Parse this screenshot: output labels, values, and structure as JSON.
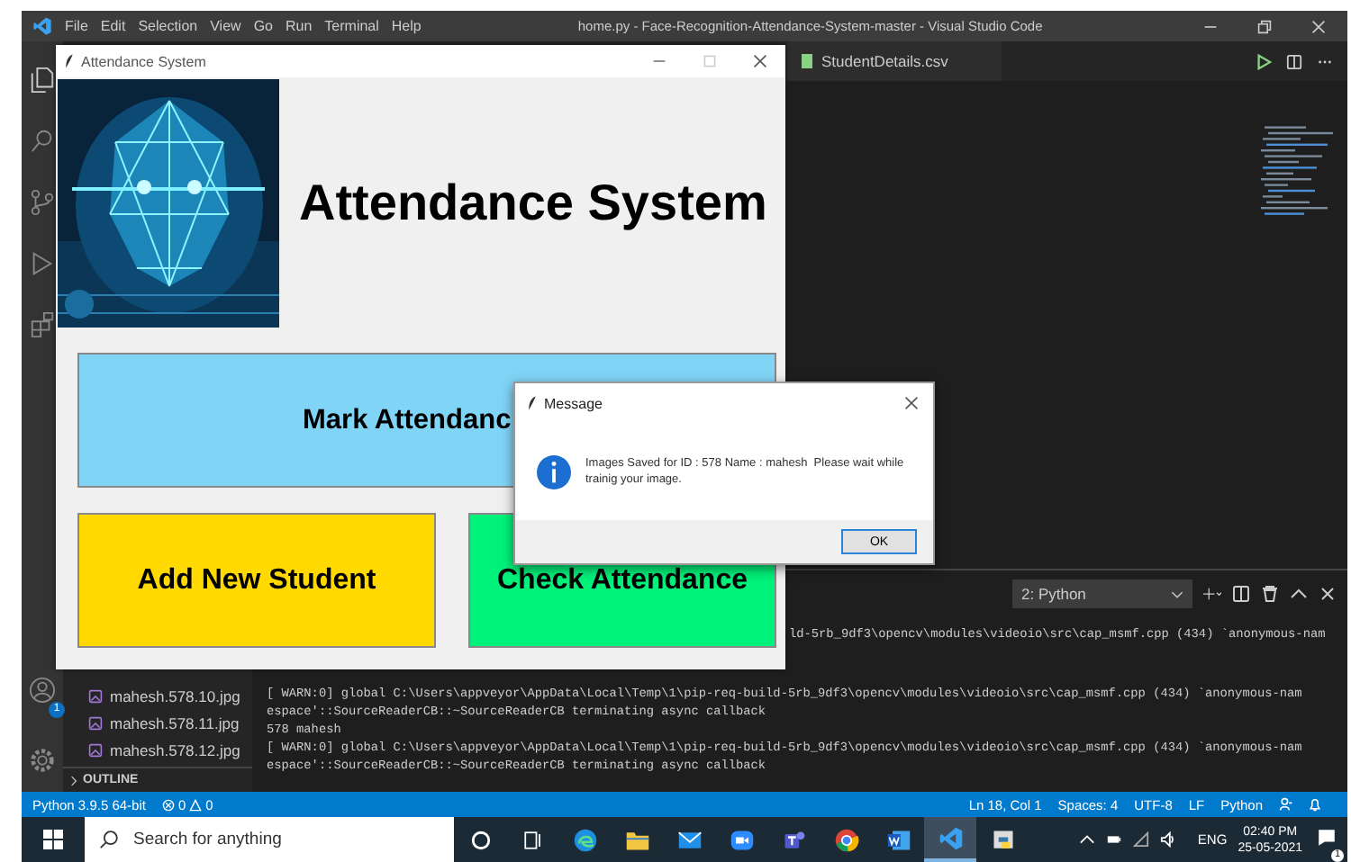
{
  "vscode": {
    "title": "home.py - Face-Recognition-Attendance-System-master - Visual Studio Code",
    "menu": [
      "File",
      "Edit",
      "Selection",
      "View",
      "Go",
      "Run",
      "Terminal",
      "Help"
    ],
    "accounts_badge": "1",
    "explorer": {
      "files": [
        "mahesh.578.10.jpg",
        "mahesh.578.11.jpg",
        "mahesh.578.12.jpg"
      ],
      "outline": "OUTLINE"
    },
    "editor_tab": "StudentDetails.csv",
    "terminal": {
      "selector": "2: Python",
      "lines": [
        {
          "kind": "clipped",
          "text": "ld-5rb_9df3\\opencv\\modules\\videoio\\src\\cap_msmf.cpp (434) `anonymous-nam"
        },
        {
          "kind": "full",
          "text": "[ WARN:0] global C:\\Users\\appveyor\\AppData\\Local\\Temp\\1\\pip-req-build-5rb_9df3\\opencv\\modules\\videoio\\src\\cap_msmf.cpp (434) `anonymous-nam"
        },
        {
          "kind": "full",
          "text": "espace'::SourceReaderCB::~SourceReaderCB terminating async callback"
        },
        {
          "kind": "full",
          "text": "578 mahesh"
        },
        {
          "kind": "full",
          "text": "[ WARN:0] global C:\\Users\\appveyor\\AppData\\Local\\Temp\\1\\pip-req-build-5rb_9df3\\opencv\\modules\\videoio\\src\\cap_msmf.cpp (434) `anonymous-nam"
        },
        {
          "kind": "full",
          "text": "espace'::SourceReaderCB::~SourceReaderCB terminating async callback"
        }
      ]
    },
    "status_bar": {
      "interpreter": "Python 3.9.5 64-bit",
      "errors": "0",
      "warnings": "0",
      "right": [
        "Ln 18, Col 1",
        "Spaces: 4",
        "UTF-8",
        "LF",
        "Python"
      ]
    }
  },
  "app_window": {
    "title": "Attendance System",
    "heading": "Attendance System",
    "buttons": [
      {
        "label": "Mark Attendanc",
        "color": "#80d4f6"
      },
      {
        "label": "Add New Student",
        "color": "#ffd900"
      },
      {
        "label": "Check Attendance",
        "color": "#00f27a"
      }
    ]
  },
  "message_dialog": {
    "title": "Message",
    "text": "Images Saved for ID : 578 Name : mahesh  Please wait while trainig your image.",
    "button": "OK"
  },
  "taskbar": {
    "search": {
      "placeholder": "Search for anything"
    },
    "apps": [
      {
        "kind": "cortana",
        "selected": false
      },
      {
        "kind": "taskview",
        "selected": false
      },
      {
        "kind": "edge",
        "selected": false
      },
      {
        "kind": "folder",
        "selected": false
      },
      {
        "kind": "mail",
        "selected": false
      },
      {
        "kind": "video",
        "selected": false
      },
      {
        "kind": "teams",
        "selected": false
      },
      {
        "kind": "chrome",
        "selected": false
      },
      {
        "kind": "word",
        "selected": false
      },
      {
        "kind": "vscode",
        "selected": true
      },
      {
        "kind": "python",
        "selected": false
      }
    ],
    "language": "ENG",
    "time": "02:40 PM",
    "date": "25-05-2021",
    "notification_badge": "1"
  }
}
